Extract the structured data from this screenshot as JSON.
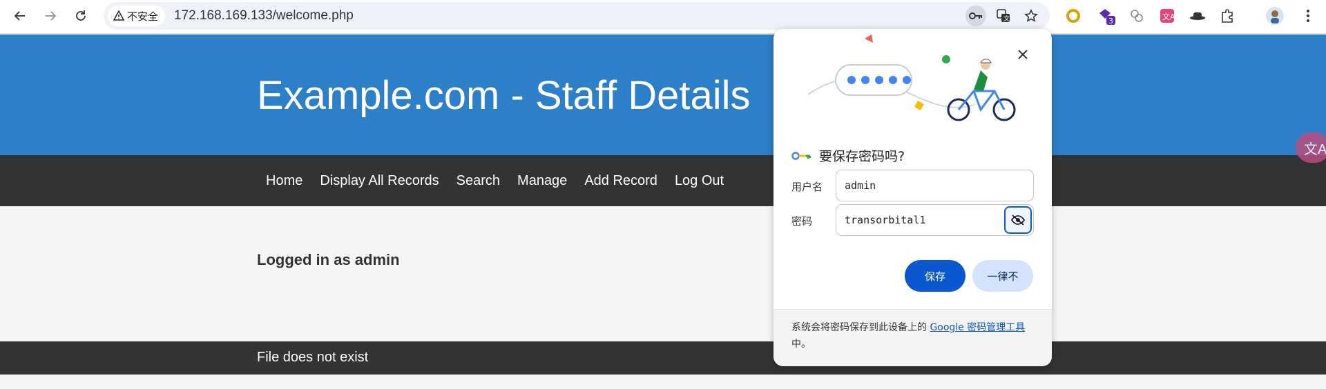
{
  "browser": {
    "security_label": "不安全",
    "url": "172.168.169.133/welcome.php",
    "extension_badge": "3"
  },
  "page": {
    "title": "Example.com - Staff Details",
    "nav": [
      "Home",
      "Display All Records",
      "Search",
      "Manage",
      "Add Record",
      "Log Out"
    ],
    "logged_in_text": "Logged in as admin",
    "footer_text": "File does not exist",
    "translate_fab": "文A"
  },
  "dialog": {
    "title": "要保存密码吗?",
    "username_label": "用户名",
    "username_value": "admin",
    "password_label": "密码",
    "password_value": "transorbital1",
    "save_label": "保存",
    "never_label": "一律不",
    "footer_prefix": "系统会将密码保存到此设备上的 ",
    "footer_link": "Google 密码管理工具",
    "footer_suffix": "中。"
  },
  "colors": {
    "header": "#2d7fc7",
    "navbar": "#333333",
    "accent": "#0b57d0"
  }
}
